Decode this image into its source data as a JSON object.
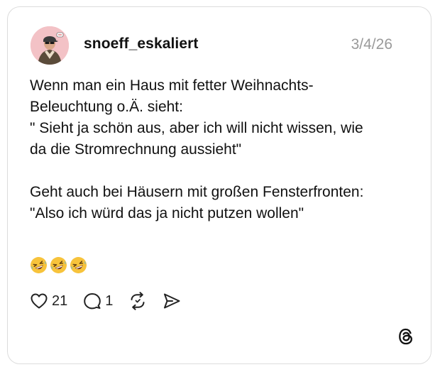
{
  "post": {
    "username": "snoeff_eskaliert",
    "date": "3/4/26",
    "lines": [
      "Wenn man ein Haus mit fetter Weihnachts-",
      "Beleuchtung o.Ä. sieht:",
      "\" Sieht ja schön aus, aber ich will nicht wissen, wie",
      "da die Stromrechnung aussieht\"",
      "",
      "Geht auch bei Häusern mit großen Fensterfronten:",
      "\"Also ich würd das ja nicht putzen wollen\""
    ],
    "emojis": [
      "rolling-on-floor-laughing",
      "rolling-on-floor-laughing",
      "rolling-on-floor-laughing"
    ]
  },
  "actions": {
    "like_count": "21",
    "reply_count": "1"
  },
  "icons": {
    "like": "heart-icon",
    "reply": "speech-bubble-icon",
    "repost": "repost-icon",
    "share": "send-icon",
    "brand": "threads-logo-icon"
  },
  "colors": {
    "text": "#111111",
    "muted": "#9a9a9a",
    "border": "#dcdcdc",
    "avatar_bg": "#f3c2c6",
    "emoji_face": "#f7c33b"
  }
}
